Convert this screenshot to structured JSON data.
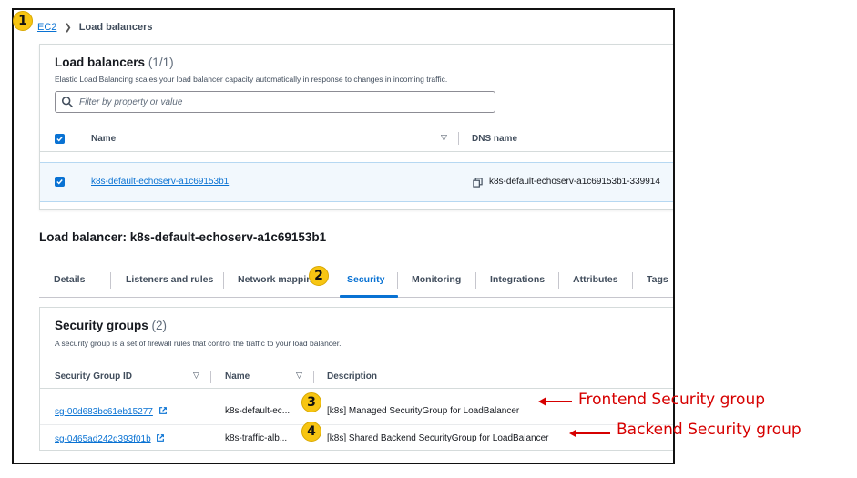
{
  "breadcrumb": {
    "root": "EC2",
    "current": "Load balancers"
  },
  "badges": {
    "b1": "1",
    "b2": "2",
    "b3": "3",
    "b4": "4"
  },
  "load_balancers": {
    "title": "Load balancers",
    "count": "(1/1)",
    "description": "Elastic Load Balancing scales your load balancer capacity automatically in response to changes in incoming traffic.",
    "filter_placeholder": "Filter by property or value",
    "columns": {
      "name": "Name",
      "dns": "DNS name"
    },
    "row": {
      "name": "k8s-default-echoserv-a1c69153b1",
      "dns": "k8s-default-echoserv-a1c69153b1-339914"
    }
  },
  "detail": {
    "heading": "Load balancer: k8s-default-echoserv-a1c69153b1",
    "tabs": [
      "Details",
      "Listeners and rules",
      "Network mapping",
      "Security",
      "Monitoring",
      "Integrations",
      "Attributes",
      "Tags"
    ],
    "active_tab": "Security"
  },
  "security_groups": {
    "title": "Security groups",
    "count": "(2)",
    "description": "A security group is a set of firewall rules that control the traffic to your load balancer.",
    "columns": {
      "id": "Security Group ID",
      "name": "Name",
      "description": "Description"
    },
    "rows": [
      {
        "id": "sg-00d683bc61eb15277",
        "name": "k8s-default-ec...",
        "description": "[k8s] Managed SecurityGroup for LoadBalancer"
      },
      {
        "id": "sg-0465ad242d393f01b",
        "name": "k8s-traffic-alb...",
        "description": "[k8s] Shared Backend SecurityGroup for LoadBalancer"
      }
    ]
  },
  "annotations": {
    "frontend": "Frontend Security group",
    "backend": "Backend Security group"
  },
  "colors": {
    "link": "#0972d3",
    "badge": "#f7c512",
    "callout": "#d60000"
  }
}
